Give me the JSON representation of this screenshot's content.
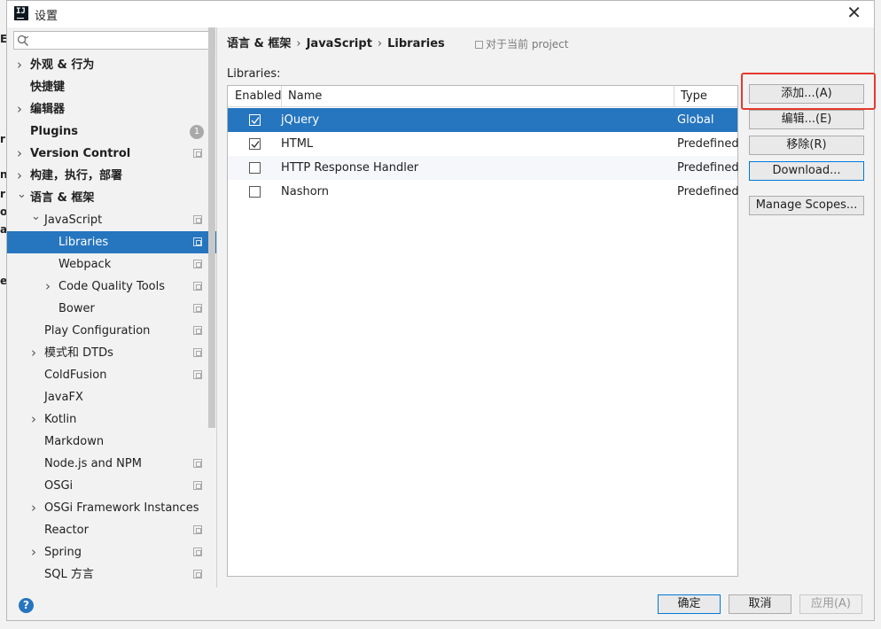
{
  "window": {
    "title": "设置"
  },
  "background": {
    "left_letters": [
      "E",
      "r",
      "n",
      "r",
      "on",
      "ax",
      "e"
    ]
  },
  "search": {
    "placeholder": ""
  },
  "tree": [
    {
      "label": "外观 & 行为",
      "level": 0,
      "expandable": true,
      "expanded": false,
      "bold": true
    },
    {
      "label": "快捷键",
      "level": 0,
      "expandable": false,
      "bold": true
    },
    {
      "label": "编辑器",
      "level": 0,
      "expandable": true,
      "expanded": false,
      "bold": true
    },
    {
      "label": "Plugins",
      "level": 0,
      "expandable": false,
      "bold": true,
      "badge": "1"
    },
    {
      "label": "Version Control",
      "level": 0,
      "expandable": true,
      "expanded": false,
      "bold": true,
      "project_icon": true
    },
    {
      "label": "构建，执行，部署",
      "level": 0,
      "expandable": true,
      "expanded": false,
      "bold": true
    },
    {
      "label": "语言 & 框架",
      "level": 0,
      "expandable": true,
      "expanded": true,
      "bold": true
    },
    {
      "label": "JavaScript",
      "level": 1,
      "expandable": true,
      "expanded": true,
      "project_icon": true
    },
    {
      "label": "Libraries",
      "level": 2,
      "expandable": false,
      "selected": true,
      "project_icon": true
    },
    {
      "label": "Webpack",
      "level": 2,
      "expandable": false,
      "project_icon": true
    },
    {
      "label": "Code Quality Tools",
      "level": 2,
      "expandable": true,
      "expanded": false,
      "project_icon": true
    },
    {
      "label": "Bower",
      "level": 2,
      "expandable": false,
      "project_icon": true
    },
    {
      "label": "Play Configuration",
      "level": 1,
      "expandable": false,
      "project_icon": true
    },
    {
      "label": "模式和 DTDs",
      "level": 1,
      "expandable": true,
      "expanded": false,
      "project_icon": true
    },
    {
      "label": "ColdFusion",
      "level": 1,
      "expandable": false,
      "project_icon": true
    },
    {
      "label": "JavaFX",
      "level": 1,
      "expandable": false
    },
    {
      "label": "Kotlin",
      "level": 1,
      "expandable": true,
      "expanded": false
    },
    {
      "label": "Markdown",
      "level": 1,
      "expandable": false
    },
    {
      "label": "Node.js and NPM",
      "level": 1,
      "expandable": false,
      "project_icon": true
    },
    {
      "label": "OSGi",
      "level": 1,
      "expandable": false,
      "project_icon": true
    },
    {
      "label": "OSGi Framework Instances",
      "level": 1,
      "expandable": true,
      "expanded": false
    },
    {
      "label": "Reactor",
      "level": 1,
      "expandable": false,
      "project_icon": true
    },
    {
      "label": "Spring",
      "level": 1,
      "expandable": true,
      "expanded": false,
      "project_icon": true
    },
    {
      "label": "SQL 方言",
      "level": 1,
      "expandable": false,
      "project_icon": true
    }
  ],
  "breadcrumb": {
    "items": [
      "语言 & 框架",
      "JavaScript",
      "Libraries"
    ],
    "separator": "›"
  },
  "scope_note": "对于当前 project",
  "libraries": {
    "label": "Libraries:",
    "columns": {
      "enabled": "Enabled",
      "name": "Name",
      "type": "Type"
    },
    "rows": [
      {
        "enabled": true,
        "name": "jQuery",
        "type": "Global",
        "selected": true
      },
      {
        "enabled": true,
        "name": "HTML",
        "type": "Predefined"
      },
      {
        "enabled": false,
        "name": "HTTP Response Handler",
        "type": "Predefined"
      },
      {
        "enabled": false,
        "name": "Nashorn",
        "type": "Predefined"
      }
    ]
  },
  "buttons": {
    "add": "添加...(A)",
    "edit": "编辑...(E)",
    "remove": "移除(R)",
    "download": "Download...",
    "manage_scopes": "Manage Scopes..."
  },
  "footer": {
    "ok": "确定",
    "cancel": "取消",
    "apply": "应用(A)",
    "help": "?"
  },
  "colors": {
    "selection": "#2675bf",
    "highlight": "#e43a2f",
    "focus": "#0078d7"
  }
}
